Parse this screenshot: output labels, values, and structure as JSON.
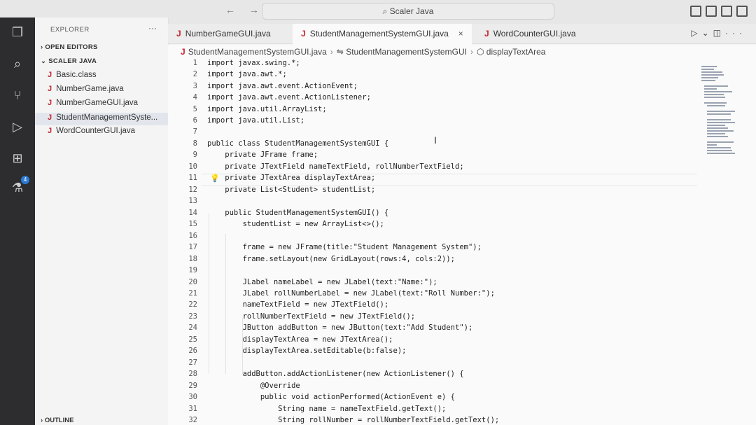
{
  "titlebar": {
    "nav": "← →",
    "command_center": "Scaler Java"
  },
  "sidebar": {
    "title": "EXPLORER",
    "more": "···",
    "open_editors": "OPEN EDITORS",
    "folder": "SCALER JAVA",
    "files": [
      "Basic.class",
      "NumberGame.java",
      "NumberGameGUI.java",
      "StudentManagementSyste...",
      "WordCounterGUI.java"
    ],
    "outline": "OUTLINE",
    "badge": "4"
  },
  "tabs": [
    {
      "label": "NumberGameGUI.java"
    },
    {
      "label": "StudentManagementSystemGUI.java",
      "close": "×"
    },
    {
      "label": "WordCounterGUI.java"
    }
  ],
  "breadcrumb": {
    "file": "StudentManagementSystemGUI.java",
    "cls": "StudentManagementSystemGUI",
    "member": "displayTextArea"
  },
  "editor": {
    "line_numbers": [
      "1",
      "2",
      "3",
      "4",
      "5",
      "6",
      "7",
      "8",
      "9",
      "10",
      "11",
      "12",
      "13",
      "14",
      "15",
      "16",
      "17",
      "18",
      "19",
      "20",
      "21",
      "22",
      "23",
      "24",
      "25",
      "26",
      "27",
      "28",
      "29",
      "30",
      "31",
      "32"
    ],
    "lines": [
      "import javax.swing.*;",
      "import java.awt.*;",
      "import java.awt.event.ActionEvent;",
      "import java.awt.event.ActionListener;",
      "import java.util.ArrayList;",
      "import java.util.List;",
      "",
      "public class StudentManagementSystemGUI {",
      "    private JFrame frame;",
      "    private JTextField nameTextField, rollNumberTextField;",
      "    private JTextArea displayTextArea;",
      "    private List<Student> studentList;",
      "",
      "    public StudentManagementSystemGUI() {",
      "        studentList = new ArrayList<>();",
      "",
      "        frame = new JFrame(title:\"Student Management System\");",
      "        frame.setLayout(new GridLayout(rows:4, cols:2));",
      "",
      "        JLabel nameLabel = new JLabel(text:\"Name:\");",
      "        JLabel rollNumberLabel = new JLabel(text:\"Roll Number:\");",
      "        nameTextField = new JTextField();",
      "        rollNumberTextField = new JTextField();",
      "        JButton addButton = new JButton(text:\"Add Student\");",
      "        displayTextArea = new JTextArea();",
      "        displayTextArea.setEditable(b:false);",
      "",
      "        addButton.addActionListener(new ActionListener() {",
      "            @Override",
      "            public void actionPerformed(ActionEvent e) {",
      "                String name = nameTextField.getText();",
      "                String rollNumber = rollNumberTextField.getText();"
    ]
  }
}
